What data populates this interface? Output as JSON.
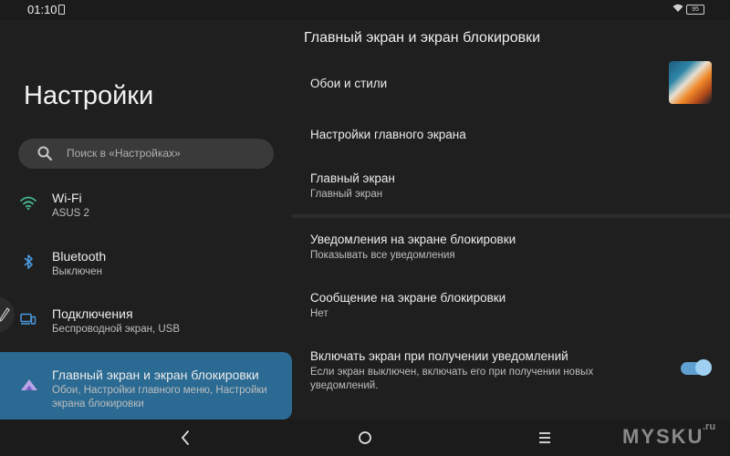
{
  "status_bar": {
    "time": "01:10",
    "battery": "95"
  },
  "app": {
    "title": "Настройки"
  },
  "search": {
    "placeholder": "Поиск в «Настройках»"
  },
  "sidebar": {
    "items": [
      {
        "label": "Wi-Fi",
        "sub": "ASUS 2",
        "icon": "wifi-icon"
      },
      {
        "label": "Bluetooth",
        "sub": "Выключен",
        "icon": "bluetooth-icon"
      },
      {
        "label": "Подключения",
        "sub": "Беспроводной экран, USB",
        "icon": "connected-devices-icon"
      },
      {
        "label": "Главный экран и экран блокировки",
        "sub": "Обои, Настройки главного меню, Настройки экрана блокировки",
        "icon": "home-lockscreen-icon",
        "active": true
      }
    ]
  },
  "main": {
    "title": "Главный экран и экран блокировки",
    "prefs": [
      {
        "title": "Обои и стили"
      },
      {
        "title": "Настройки главного экрана"
      },
      {
        "title": "Главный экран",
        "sub": "Главный экран"
      },
      {
        "title": "Уведомления на экране блокировки",
        "sub": "Показывать все уведомления"
      },
      {
        "title": "Сообщение на экране блокировки",
        "sub": "Нет"
      },
      {
        "title": "Включать экран при получении уведомлений",
        "sub": "Если экран выключен, включать его при получении новых уведомлений.",
        "toggle": true
      }
    ]
  },
  "watermark": {
    "text": "MYSKU",
    "sup": ".ru"
  },
  "colors": {
    "accent": "#2a6a93",
    "toggle_on": "#5fa0d0",
    "background": "#1f1f1f"
  }
}
